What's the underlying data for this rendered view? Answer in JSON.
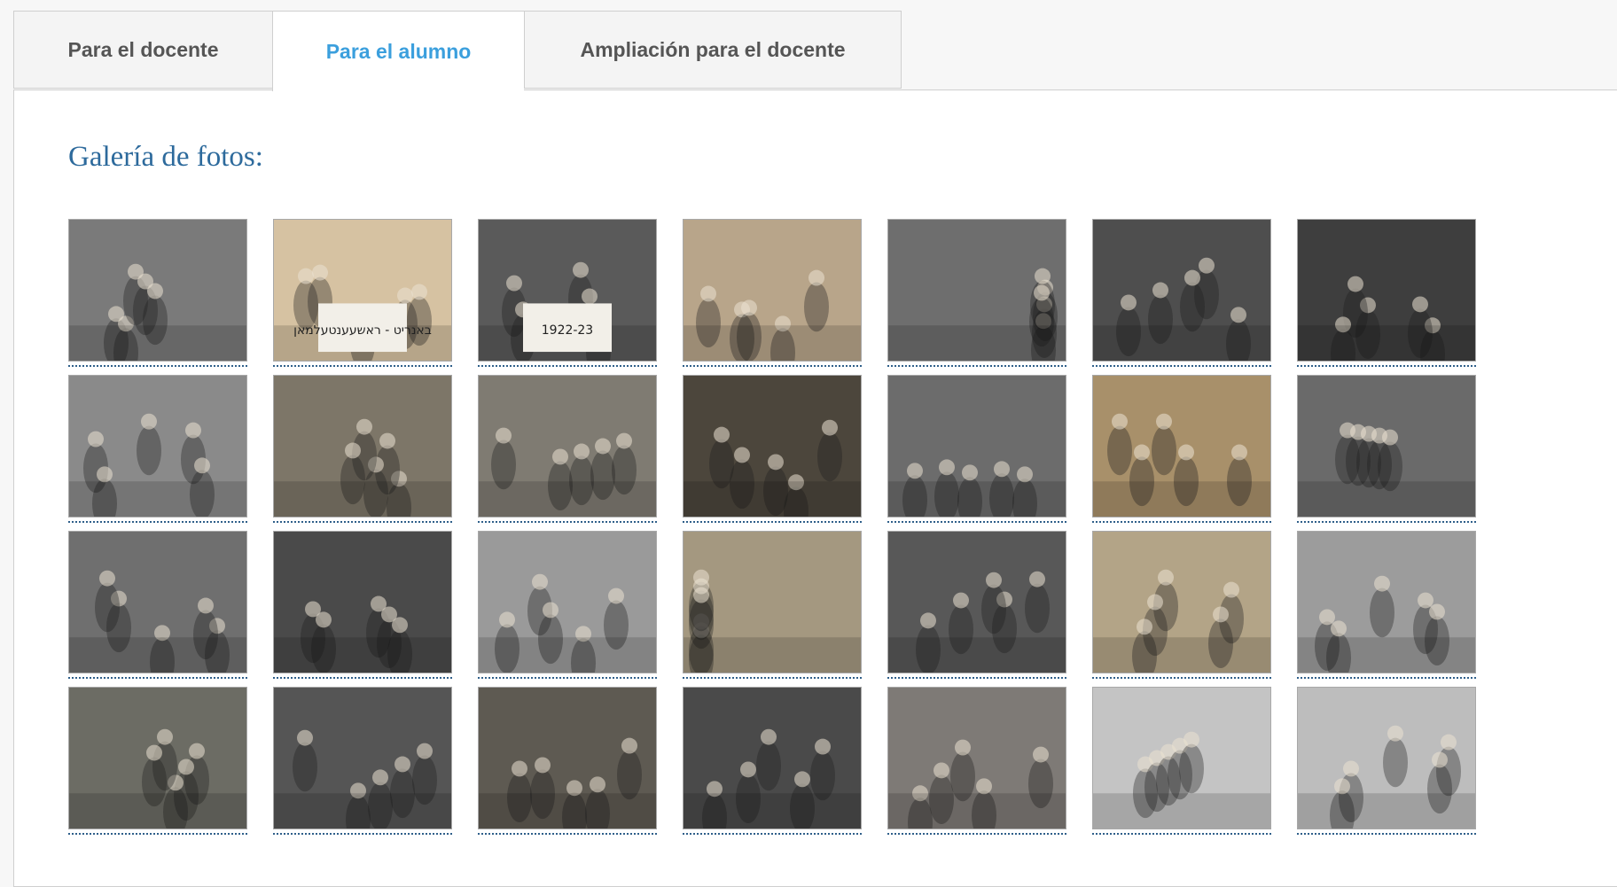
{
  "tabs": [
    {
      "label": "Para el docente"
    },
    {
      "label": "Para el alumno"
    },
    {
      "label": "Ampliación para el docente"
    }
  ],
  "gallery": {
    "title": "Galería de fotos:",
    "photos": [
      {
        "name": "photo-boy-with-book",
        "tone": "#7a7a7a"
      },
      {
        "name": "photo-hebrew-poster",
        "tone": "#d6c2a2",
        "sign_text": "באנריט - ראשעענטעלמאן"
      },
      {
        "name": "photo-class-1922-23",
        "tone": "#5a5a5a",
        "sign_text": "1922-23"
      },
      {
        "name": "photo-child-at-sea",
        "tone": "#b8a58a"
      },
      {
        "name": "photo-rowing-boat",
        "tone": "#6e6e6e"
      },
      {
        "name": "photo-banner-star-of-david",
        "tone": "#4e4e4e"
      },
      {
        "name": "photo-football-team",
        "tone": "#3e3e3e"
      },
      {
        "name": "photo-mother-and-children",
        "tone": "#8a8a8a"
      },
      {
        "name": "photo-family-group",
        "tone": "#7d7668"
      },
      {
        "name": "photo-family-outdoors",
        "tone": "#7f7b72"
      },
      {
        "name": "photo-woman-and-boy",
        "tone": "#4c463c"
      },
      {
        "name": "photo-child-with-doll",
        "tone": "#6c6c6c"
      },
      {
        "name": "photo-synagogue-building",
        "tone": "#a8906a"
      },
      {
        "name": "photo-children-group",
        "tone": "#6a6a6a"
      },
      {
        "name": "photo-two-boys",
        "tone": "#6f6f6f"
      },
      {
        "name": "photo-gymnastics",
        "tone": "#4a4a4a"
      },
      {
        "name": "photo-rabbi-and-children",
        "tone": "#9a9a9a"
      },
      {
        "name": "photo-youth-group",
        "tone": "#a49880"
      },
      {
        "name": "photo-dancing-circle",
        "tone": "#585858"
      },
      {
        "name": "photo-costumed-children",
        "tone": "#b3a487"
      },
      {
        "name": "photo-street-children",
        "tone": "#9c9c9c"
      },
      {
        "name": "photo-youth-with-flag",
        "tone": "#6c6c64"
      },
      {
        "name": "photo-chess-player",
        "tone": "#555555"
      },
      {
        "name": "photo-crowd-street",
        "tone": "#5e5a52"
      },
      {
        "name": "photo-torah-ark",
        "tone": "#4a4a4a"
      },
      {
        "name": "photo-street-scene",
        "tone": "#7e7a76"
      },
      {
        "name": "photo-boy-in-cap",
        "tone": "#c4c4c4"
      },
      {
        "name": "photo-child-with-menorah",
        "tone": "#bdbdbd"
      }
    ]
  }
}
